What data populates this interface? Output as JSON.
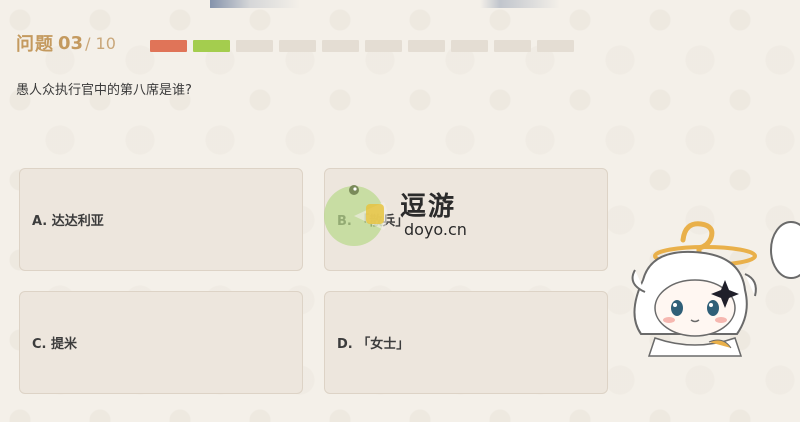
{
  "header": {
    "label": "问题",
    "current": "03",
    "total": "/ 10"
  },
  "progress": {
    "total": 10,
    "states": [
      "wrong",
      "right",
      "pending",
      "pending",
      "pending",
      "pending",
      "pending",
      "pending",
      "pending",
      "pending"
    ]
  },
  "question": {
    "text": "愚人众执行官中的第八席是谁?"
  },
  "options": [
    {
      "label": "A. 达达利亚"
    },
    {
      "label": "B. 「散兵」"
    },
    {
      "label": "C. 提米"
    },
    {
      "label": "D. 「女士」"
    }
  ],
  "watermark": {
    "title": "逗游",
    "url": "doyo.cn"
  },
  "colors": {
    "accent": "#c49a5f",
    "wrong": "#e07458",
    "right": "#a4cd4e",
    "pending": "#e4ddd3",
    "option_bg": "#ede6dd"
  },
  "icons": {
    "mascot": "paimon-character",
    "watermark_logo": "doyo-logo-icon"
  }
}
